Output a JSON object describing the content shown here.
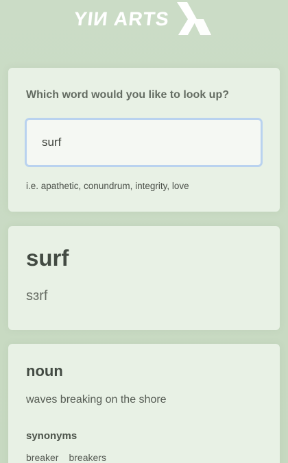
{
  "brand": {
    "name": "YIИ ARTS",
    "logo_icon": "yin-arts-mark-icon"
  },
  "search": {
    "prompt": "Which word would you like to look up?",
    "value": "surf",
    "hint": "i.e. apathetic, conundrum, integrity, love"
  },
  "result": {
    "word": "surf",
    "phonetic": "sɜrf"
  },
  "meaning": {
    "part_of_speech": "noun",
    "definition": "waves breaking on the shore",
    "synonyms_title": "synonyms",
    "synonyms": [
      "breaker",
      "breakers"
    ]
  },
  "colors": {
    "background": "#c9dcc4",
    "card": "#e8f1e5",
    "input_border": "#b9d2ef",
    "heading": "#434b43"
  }
}
